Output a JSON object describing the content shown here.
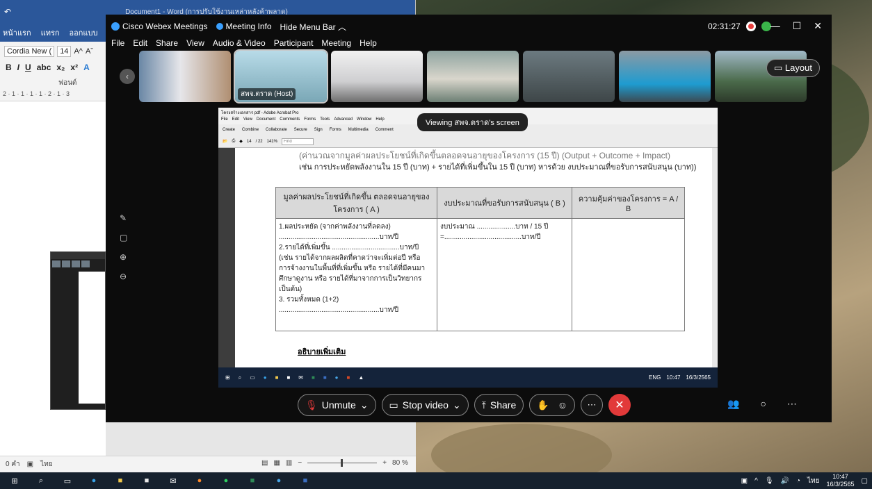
{
  "word": {
    "title": "Document1 - Word (การปรับใช้งานเหล่าหลังค้าพลาด)",
    "tabs": [
      "หน้าแรก",
      "แทรก",
      "ออกแบบ"
    ],
    "font_name": "Cordia New (",
    "font_size": "14",
    "group_label": "ฟอนต์",
    "ruler": "2 · 1 · 1 · 1 · 1 · 2 · 1 · 3",
    "status_words": "0 คำ",
    "status_lang": "ไทย",
    "zoom": "80 %"
  },
  "webex": {
    "brand": "Cisco Webex Meetings",
    "meeting_info": "Meeting Info",
    "hide_menu": "Hide Menu Bar",
    "clock": "02:31:27",
    "menu": [
      "File",
      "Edit",
      "Share",
      "View",
      "Audio & Video",
      "Participant",
      "Meeting",
      "Help"
    ],
    "host_caption": "สพจ.ตราด (Host)",
    "layout_label": "Layout",
    "viewing_banner": "Viewing สพจ.ตราด's screen",
    "controls": {
      "unmute": "Unmute",
      "stop_video": "Stop video",
      "share": "Share"
    }
  },
  "acrobat": {
    "title": "โครงสร้างเอกสาร pdf - Adobe Acrobat Pro",
    "menu": [
      "File",
      "Edit",
      "View",
      "Document",
      "Comments",
      "Forms",
      "Tools",
      "Advanced",
      "Window",
      "Help"
    ],
    "toolbar": [
      "Create",
      "Combine",
      "Collaborate",
      "Secure",
      "Sign",
      "Forms",
      "Multimedia",
      "Comment"
    ],
    "page_current": "14",
    "page_total": "/ 22",
    "zoom": "141%",
    "find_placeholder": "Find"
  },
  "document": {
    "line1": "(ค่านวณจากมูลค่าผลประโยชน์ที่เกิดขึ้นตลอดจนอายุของโครงการ (15 ปี) (Output + Outcome + Impact)",
    "line2": "เช่น การประหยัดพลังงานใน 15 ปี (บาท) + รายได้ที่เพิ่มขึ้นใน 15 ปี (บาท) หารด้วย งบประมาณที่ขอรับการสนับสนุน (บาท))",
    "headers": [
      "มูลค่าผลประโยชน์ที่เกิดขึ้น ตลอดจนอายุของโครงการ ( A )",
      "งบประมาณที่ขอรับการสนับสนุน ( B )",
      "ความคุ้มค่าของโครงการ = A / B"
    ],
    "col_a": [
      "1.ผลประหยัด (จากค่าพลังงานที่ลดลง)",
      "....................................................บาท/ปี",
      "2.รายได้ที่เพิ่มขึ้น ...................................บาท/ปี",
      "(เช่น รายได้จากผลผลิตที่คาดว่าจะเพิ่มต่อปี หรือ การจ้างงานในพื้นที่ที่เพิ่มขึ้น หรือ รายได้ที่มีคนมาศึกษาดูงาน หรือ รายได้ที่มาจากการเป็นวิทยากร เป็นต้น)",
      "3. รวมทั้งหมด (1+2)",
      "....................................................บาท/ปี"
    ],
    "col_b": [
      "งบประมาณ ....................บาท / 15 ปี",
      "=........................................บาท/ปี"
    ],
    "more": "อธิบายเพิ่มเติม",
    "inner_clock_time": "10:47",
    "inner_clock_date": "16/3/2565",
    "inner_lang": "ENG"
  },
  "taskbar": {
    "time": "10:47",
    "date": "16/3/2565",
    "lang": "ไทย"
  }
}
